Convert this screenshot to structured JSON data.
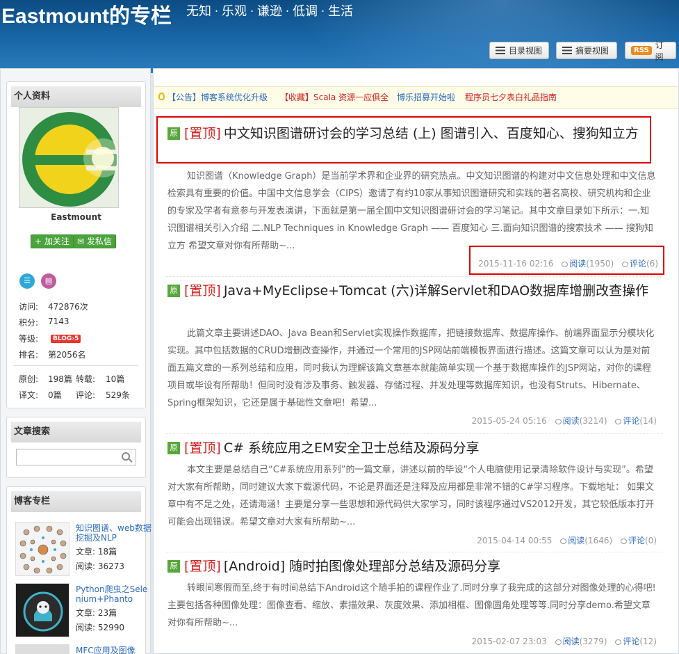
{
  "header": {
    "title": "Eastmount的专栏",
    "subtitle": "无知 · 乐观 · 谦逊 · 低调 · 生活",
    "buttons": {
      "catalog_view": "目录视图",
      "summary_view": "摘要视图",
      "rss_badge": "RSS",
      "subscribe": "订阅"
    }
  },
  "profile": {
    "panel_title": "个人资料",
    "username": "Eastmount",
    "follow": "加关注",
    "message": "发私信",
    "stats": [
      {
        "label": "访问:",
        "value": "472876次"
      },
      {
        "label": "积分:",
        "value": "7143"
      },
      {
        "label": "等级:",
        "value": "BLOG",
        "level": "5"
      },
      {
        "label": "排名:",
        "value": "第2056名"
      }
    ],
    "counts": {
      "original_label": "原创:",
      "original": "198篇",
      "repost_label": "转载:",
      "repost": "10篇",
      "translate_label": "译文:",
      "translate": "0篇",
      "comment_label": "评论:",
      "comment": "529条"
    }
  },
  "search": {
    "panel_title": "文章搜索",
    "placeholder": ""
  },
  "columns": {
    "panel_title": "博客专栏",
    "items": [
      {
        "title": "知识图谱、web数据挖掘及NLP",
        "articles_label": "文章:",
        "articles": "18篇",
        "reads_label": "阅读:",
        "reads": "36273"
      },
      {
        "title": "Python爬虫之Selenium+Phanto",
        "articles_label": "文章:",
        "articles": "23篇",
        "reads_label": "阅读:",
        "reads": "52990"
      },
      {
        "title": "MFC应用及图像",
        "articles_label": "",
        "articles": "",
        "reads_label": "",
        "reads": ""
      }
    ]
  },
  "notice": {
    "items": [
      "【公告】博客系统优化升级",
      "【收藏】Scala 资源一应俱全",
      "博乐招募开始啦",
      "程序员七夕表白礼品指南"
    ],
    "colors": [
      "#2b6bbf",
      "#d41f1f",
      "#2b6bbf",
      "#d41f1f"
    ]
  },
  "articles": [
    {
      "badge": "原",
      "pin": "[置顶]",
      "title": "中文知识图谱研讨会的学习总结 (上) 图谱引入、百度知心、搜狗知立方",
      "summary": "知识图谱（Knowledge Graph）是当前学术界和企业界的研究热点。中文知识图谱的构建对中文信息处理和中文信息检索具有重要的价值。中国中文信息学会（CIPS）邀请了有约10家从事知识图谱研究和实践的著名高校、研究机构和企业的专家及学者有意参与开发表演讲，下面就是第一届全国中文知识图谱研讨会的学习笔记。其中文章目录如下所示：一.知识图谱相关引入介绍 二.NLP Techniques in Knowledge Graph —— 百度知心 三.面向知识图谱的搜索技术 —— 搜狗知立方 希望文章对你有所帮助~...",
      "date": "2015-11-16 02:16",
      "read_label": "阅读",
      "reads": "(1950)",
      "comment_label": "评论",
      "comments": "(6)"
    },
    {
      "badge": "原",
      "pin": "[置顶]",
      "title": "Java+MyEclipse+Tomcat (六)详解Servlet和DAO数据库增删改查操作",
      "summary": "此篇文章主要讲述DAO、Java Bean和Servlet实现操作数据库，把链接数据库、数据库操作、前端界面显示分模块化实现。其中包括数据的CRUD增删改查操作，并通过一个常用的JSP网站前端模板界面进行描述。这篇文章可以认为是对前面五篇文章的一系列总结和应用，同时我认为理解该篇文章基本就能简单实现一个基于数据库操作的JSP网站，对你的课程项目或毕设有所帮助！但同时没有涉及事务、触发器、存储过程、并发处理等数据库知识，也没有Struts、Hibernate、Spring框架知识，它还是属于基础性文章吧！希望...",
      "date": "2015-05-24 05:16",
      "read_label": "阅读",
      "reads": "(3214)",
      "comment_label": "评论",
      "comments": "(14)"
    },
    {
      "badge": "原",
      "pin": "[置顶]",
      "title": "C# 系统应用之EM安全卫士总结及源码分享",
      "summary": "本文主要是总结自己“C#系统应用系列”的一篇文章，讲述以前的毕设“个人电脑使用记录清除软件设计与实现”。希望对大家有所帮助，同时建议大家下载源代码，不论是界面还是注释及应用都是非常不错的C#学习程序。下载地址： 如果文章中有不足之处，还请海涵！主要是分享一些思想和源代码供大家学习，同时该程序通过VS2012开发，其它较低版本打开可能会出现错误。希望文章对大家有所帮助~...",
      "date": "2015-04-14 00:55",
      "read_label": "阅读",
      "reads": "(1646)",
      "comment_label": "评论",
      "comments": "(0)"
    },
    {
      "badge": "原",
      "pin": "[置顶]",
      "title": "[Android] 随时拍图像处理部分总结及源码分享",
      "summary": "转眼间寒假而至,终于有时间总结下Android这个随手拍的课程作业了.同时分享了我完成的这部分对图像处理的心得吧!主要包括各种图像处理：图像查看、缩放、素描效果、灰度效果、添加相框、图像圆角处理等等.同时分享demo.希望文章对你有所帮助~...",
      "date": "2015-02-07 23:03",
      "read_label": "阅读",
      "reads": "(3279)",
      "comment_label": "评论",
      "comments": "(12)"
    }
  ]
}
